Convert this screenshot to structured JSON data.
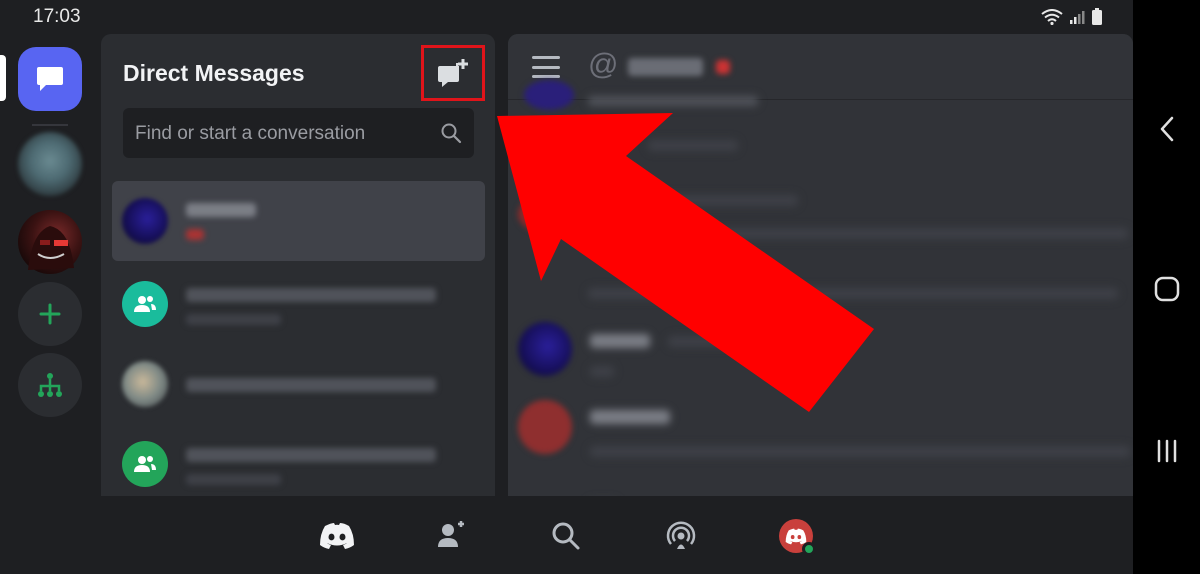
{
  "status_bar": {
    "time": "17:03"
  },
  "dm_panel": {
    "title": "Direct Messages",
    "search_placeholder": "Find or start a conversation"
  },
  "icons": {
    "dm_home": "chat-bubble-icon",
    "new_dm": "chat-plus-icon",
    "search": "search-icon",
    "add_server": "plus-icon",
    "explore": "hub-icon",
    "group_dm": "group-icon",
    "menu": "hamburger-icon",
    "nav_home": "discord-logo-icon",
    "nav_friends": "friends-icon",
    "nav_search": "search-icon",
    "nav_notifications": "broadcast-icon",
    "nav_profile": "avatar-icon",
    "sys_back": "chevron-left-icon",
    "sys_home": "rounded-square-icon",
    "sys_recents": "three-bars-icon"
  },
  "colors": {
    "accent": "#5865f2",
    "green": "#23a55a",
    "highlight_red": "#e0141a",
    "arrow_red": "#ff0000",
    "panel_bg": "#2b2d31",
    "chat_bg": "#313338",
    "base_bg": "#1e1f22"
  }
}
